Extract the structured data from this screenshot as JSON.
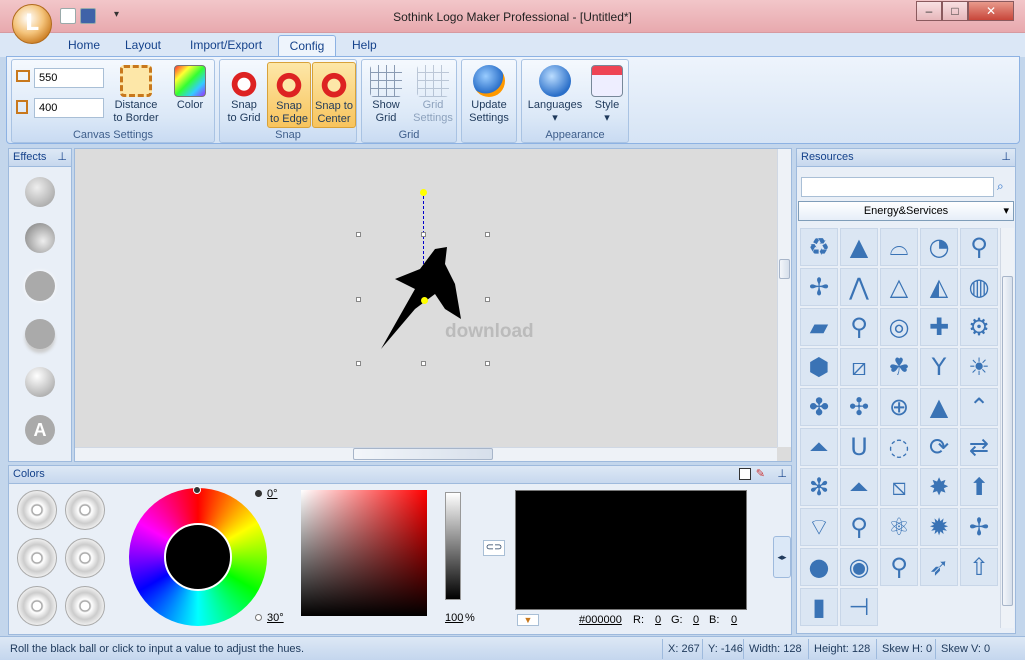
{
  "window": {
    "title": "Sothink Logo Maker Professional - [Untitled*]",
    "minimize": "–",
    "maximize": "□",
    "close": "✕"
  },
  "tabs": [
    "Home",
    "Layout",
    "Import/Export",
    "Config",
    "Help"
  ],
  "active_tab": "Config",
  "ribbon": {
    "canvas_settings": {
      "label": "Canvas Settings",
      "width": "550",
      "height": "400",
      "distance_to_border": "Distance\nto Border",
      "color": "Color"
    },
    "snap": {
      "label": "Snap",
      "snap_to_grid": "Snap\nto Grid",
      "snap_to_edge": "Snap\nto Edge",
      "snap_to_center": "Snap to\nCenter"
    },
    "grid": {
      "label": "Grid",
      "show_grid": "Show\nGrid",
      "grid_settings": "Grid\nSettings"
    },
    "update": {
      "update_settings": "Update\nSettings"
    },
    "appearance": {
      "label": "Appearance",
      "languages": "Languages",
      "style": "Style"
    }
  },
  "panels": {
    "effects": "Effects",
    "resources": "Resources",
    "colors": "Colors"
  },
  "resources": {
    "search_placeholder": "",
    "category": "Energy&Services",
    "icons": [
      "recycle",
      "mountain",
      "radar-dish",
      "satellite-dish",
      "antenna",
      "fan",
      "triangle-lines",
      "pyramid",
      "sail",
      "sphere",
      "parallelogram",
      "bulb",
      "spiral",
      "cross",
      "gear",
      "blob",
      "slash-box",
      "trefoil",
      "y-shape",
      "sunburst",
      "pinwheel",
      "cross-dots",
      "circle-cross",
      "triangle",
      "roof",
      "house-tri",
      "u-shape",
      "dot-ring",
      "refresh",
      "arrows",
      "windmill",
      "up-box",
      "diag-box",
      "explosion",
      "up-arrow-box",
      "dish",
      "lightbulb2",
      "trefoil2",
      "sun",
      "turbine",
      "bomb",
      "bomb2",
      "pin",
      "rocket",
      "shuttle",
      "capsule",
      "cannon"
    ]
  },
  "colors": {
    "hue_angle": "0°",
    "wheel_angle": "30°",
    "alpha_percent": "100",
    "percent_sign": "%",
    "hex": "#000000",
    "r_label": "R:",
    "r": "0",
    "g_label": "G:",
    "g": "0",
    "b_label": "B:",
    "b": "0",
    "preview_color": "#000000"
  },
  "status": {
    "message": "Roll the black ball or click to input a value to adjust the hues.",
    "x": "X: 267",
    "y": "Y: -146",
    "width": "Width: 128",
    "height": "Height: 128",
    "skew_h": "Skew H: 0",
    "skew_v": "Skew V: 0"
  },
  "canvas": {
    "watermark": "download"
  }
}
